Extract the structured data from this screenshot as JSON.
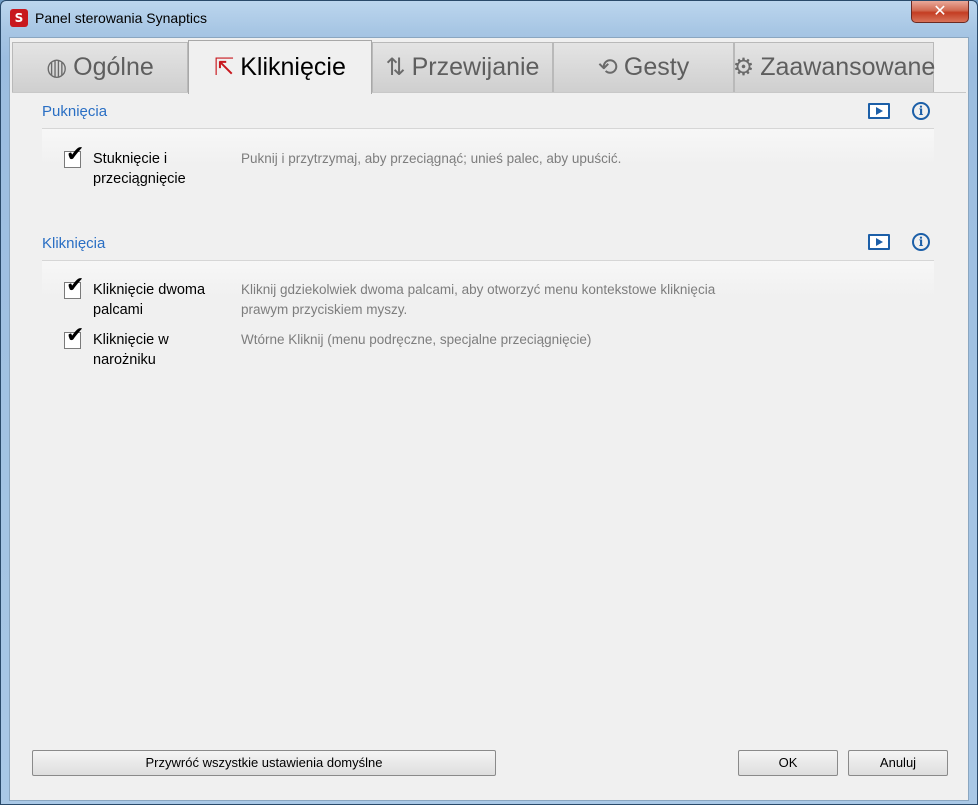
{
  "window": {
    "title": "Panel sterowania Synaptics",
    "close_label": "✕"
  },
  "tabs": [
    {
      "label": "Ogólne",
      "icon": "synaptics-logo-icon",
      "glyph": "◍",
      "active": false
    },
    {
      "label": "Kliknięcie",
      "icon": "click-cursor-icon",
      "glyph": "⇱",
      "active": true
    },
    {
      "label": "Przewijanie",
      "icon": "scroll-arrows-icon",
      "glyph": "⇅",
      "active": false
    },
    {
      "label": "Gesty",
      "icon": "rotate-gesture-icon",
      "glyph": "⟲",
      "active": false
    },
    {
      "label": "Zaawansowane",
      "icon": "gear-icon",
      "glyph": "⚙",
      "active": false
    }
  ],
  "sections": [
    {
      "title": "Puknięcia",
      "options": [
        {
          "label": "Stuknięcie i przeciągnięcie",
          "checked": true,
          "description": "Puknij i przytrzymaj, aby przeciągnąć; unieś palec, aby upuścić."
        }
      ]
    },
    {
      "title": "Kliknięcia",
      "options": [
        {
          "label": "Kliknięcie dwoma palcami",
          "checked": true,
          "description": "Kliknij gdziekolwiek dwoma palcami, aby otworzyć menu kontekstowe kliknięcia prawym przyciskiem myszy."
        },
        {
          "label": "Kliknięcie w narożniku",
          "checked": true,
          "description": "Wtórne Kliknij (menu podręczne, specjalne przeciągnięcie)"
        }
      ]
    }
  ],
  "icons": {
    "video": "video-play-icon",
    "info": "info-icon",
    "info_glyph": "i",
    "check_glyph": "✔"
  },
  "buttons": {
    "restore_defaults": "Przywróć wszystkie ustawienia domyślne",
    "ok": "OK",
    "cancel": "Anuluj"
  }
}
